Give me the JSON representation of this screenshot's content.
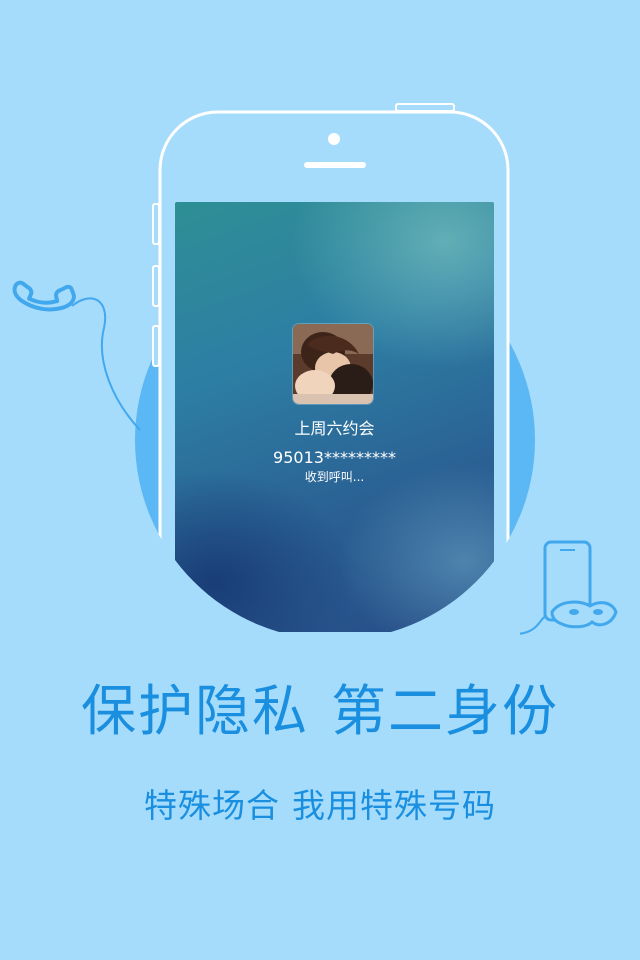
{
  "call_screen": {
    "caller_name": "上周六约会",
    "caller_number": "95013*********",
    "status": "收到呼叫..."
  },
  "promo": {
    "headline_part1": "保护隐私",
    "headline_part2": "第二身份",
    "subline_part1": "特殊场合",
    "subline_part2": "我用特殊号码"
  },
  "icons": {
    "left": "phone-handset-icon",
    "right": "phone-with-mask-icon"
  },
  "colors": {
    "background": "#a6dcfb",
    "accent": "#1a8fe0",
    "circle": "#5cb8f4",
    "line": "#42a8ee"
  }
}
